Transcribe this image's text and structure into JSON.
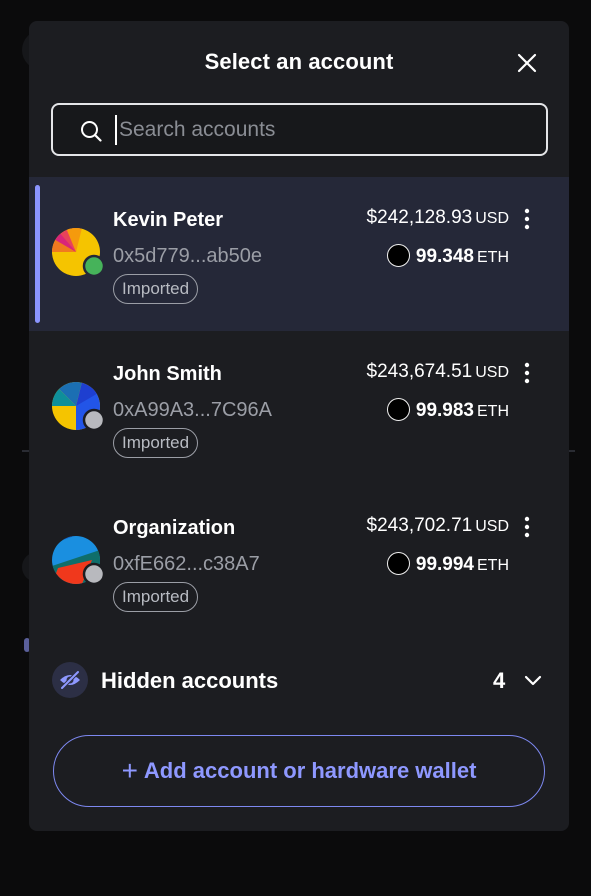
{
  "modal": {
    "title": "Select an account",
    "close_icon": "close-icon"
  },
  "search": {
    "placeholder": "Search accounts",
    "icon": "search-icon"
  },
  "accounts": [
    {
      "name": "Kevin Peter",
      "address": "0x5d779...ab50e",
      "tag": "Imported",
      "fiat_value": "$242,128.93",
      "fiat_unit": "USD",
      "crypto_value": "99.348",
      "crypto_unit": "ETH",
      "selected": true
    },
    {
      "name": "John Smith",
      "address": "0xA99A3...7C96A",
      "tag": "Imported",
      "fiat_value": "$243,674.51",
      "fiat_unit": "USD",
      "crypto_value": "99.983",
      "crypto_unit": "ETH",
      "selected": false
    },
    {
      "name": "Organization",
      "address": "0xfE662...c38A7",
      "tag": "Imported",
      "fiat_value": "$243,702.71",
      "fiat_unit": "USD",
      "crypto_value": "99.994",
      "crypto_unit": "ETH",
      "selected": false
    }
  ],
  "hidden_accounts": {
    "label": "Hidden accounts",
    "count": "4",
    "icon": "eye-slash-icon"
  },
  "add_button": {
    "label": "Add account or hardware wallet",
    "icon": "plus-icon"
  },
  "colors": {
    "modal_bg": "#1c1d21",
    "selected_bg": "#252838",
    "accent": "#8e98ff",
    "muted_text": "#9b9ea6",
    "connected_dot": "#46b35a",
    "disconnected_dot": "#b8b9be"
  }
}
